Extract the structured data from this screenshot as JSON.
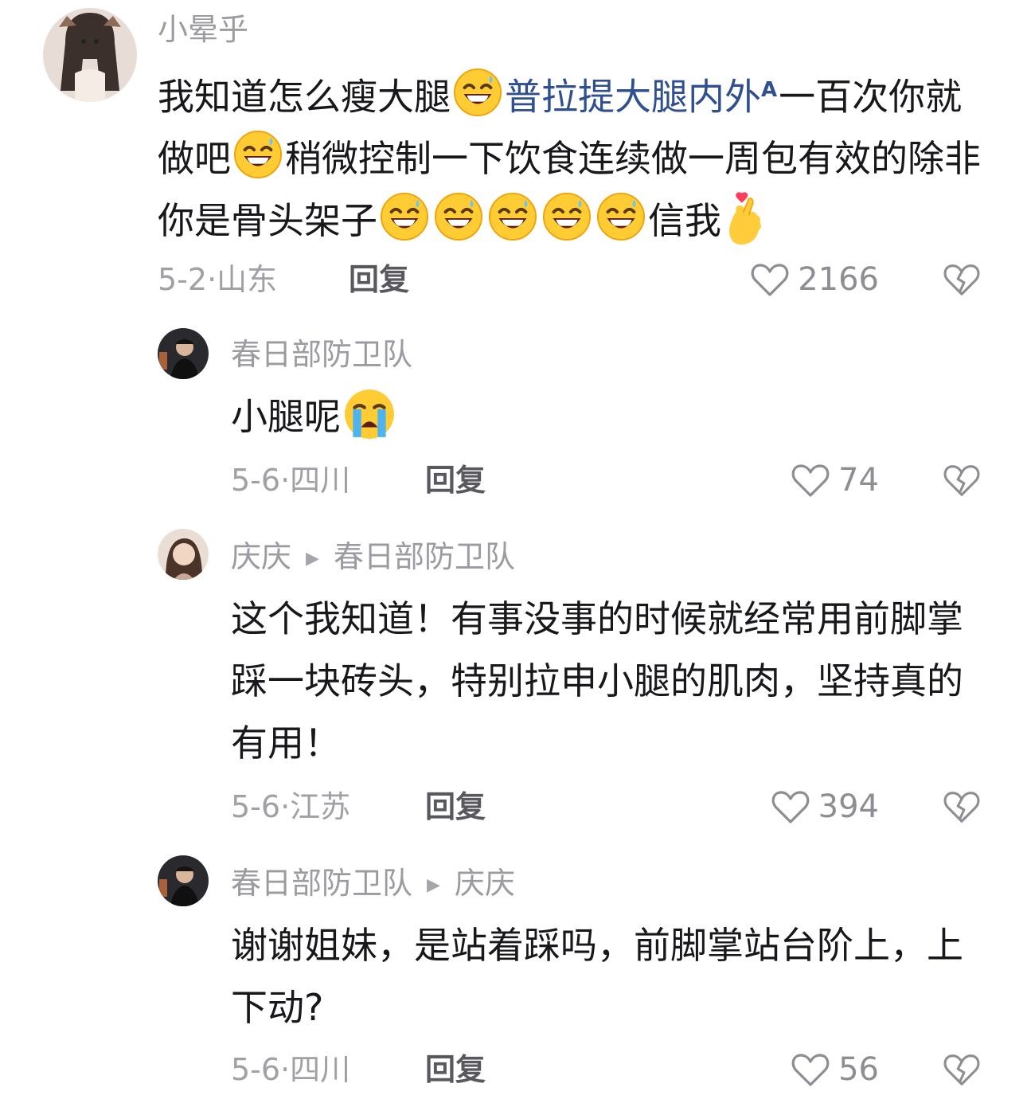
{
  "comments": [
    {
      "author": "小晕乎",
      "segments": [
        "我知道怎么瘦大腿",
        "普拉提大腿内外",
        "一百次你就做吧",
        "稍微控制一下饮食连续做一周包有效的除非你是骨头架子",
        "信我"
      ],
      "date": "5-2",
      "location": "山东",
      "reply_label": "回复",
      "likes": "2166"
    },
    {
      "author": "春日部防卫队",
      "text": "小腿呢",
      "date": "5-6",
      "location": "四川",
      "reply_label": "回复",
      "likes": "74"
    },
    {
      "author": "庆庆",
      "reply_to": "春日部防卫队",
      "text": "这个我知道！有事没事的时候就经常用前脚掌踩一块砖头，特别拉申小腿的肌肉，坚持真的有用！",
      "date": "5-6",
      "location": "江苏",
      "reply_label": "回复",
      "likes": "394"
    },
    {
      "author": "春日部防卫队",
      "reply_to": "庆庆",
      "text": "谢谢姐妹，是站着踩吗，前脚掌站台阶上，上下动?",
      "date": "5-6",
      "location": "四川",
      "reply_label": "回复",
      "likes": "56"
    }
  ],
  "icons": {
    "like": "heart-outline-icon",
    "dislike": "broken-heart-icon",
    "emoji_grin": "grinning-sweat-emoji",
    "emoji_cry": "loudly-crying-emoji",
    "emoji_heart_hand": "finger-heart-emoji",
    "search_lens": "search-lens-icon"
  },
  "colors": {
    "link": "#2f4f8f",
    "meta": "#a0a0a6",
    "author": "#9b9ba1"
  }
}
